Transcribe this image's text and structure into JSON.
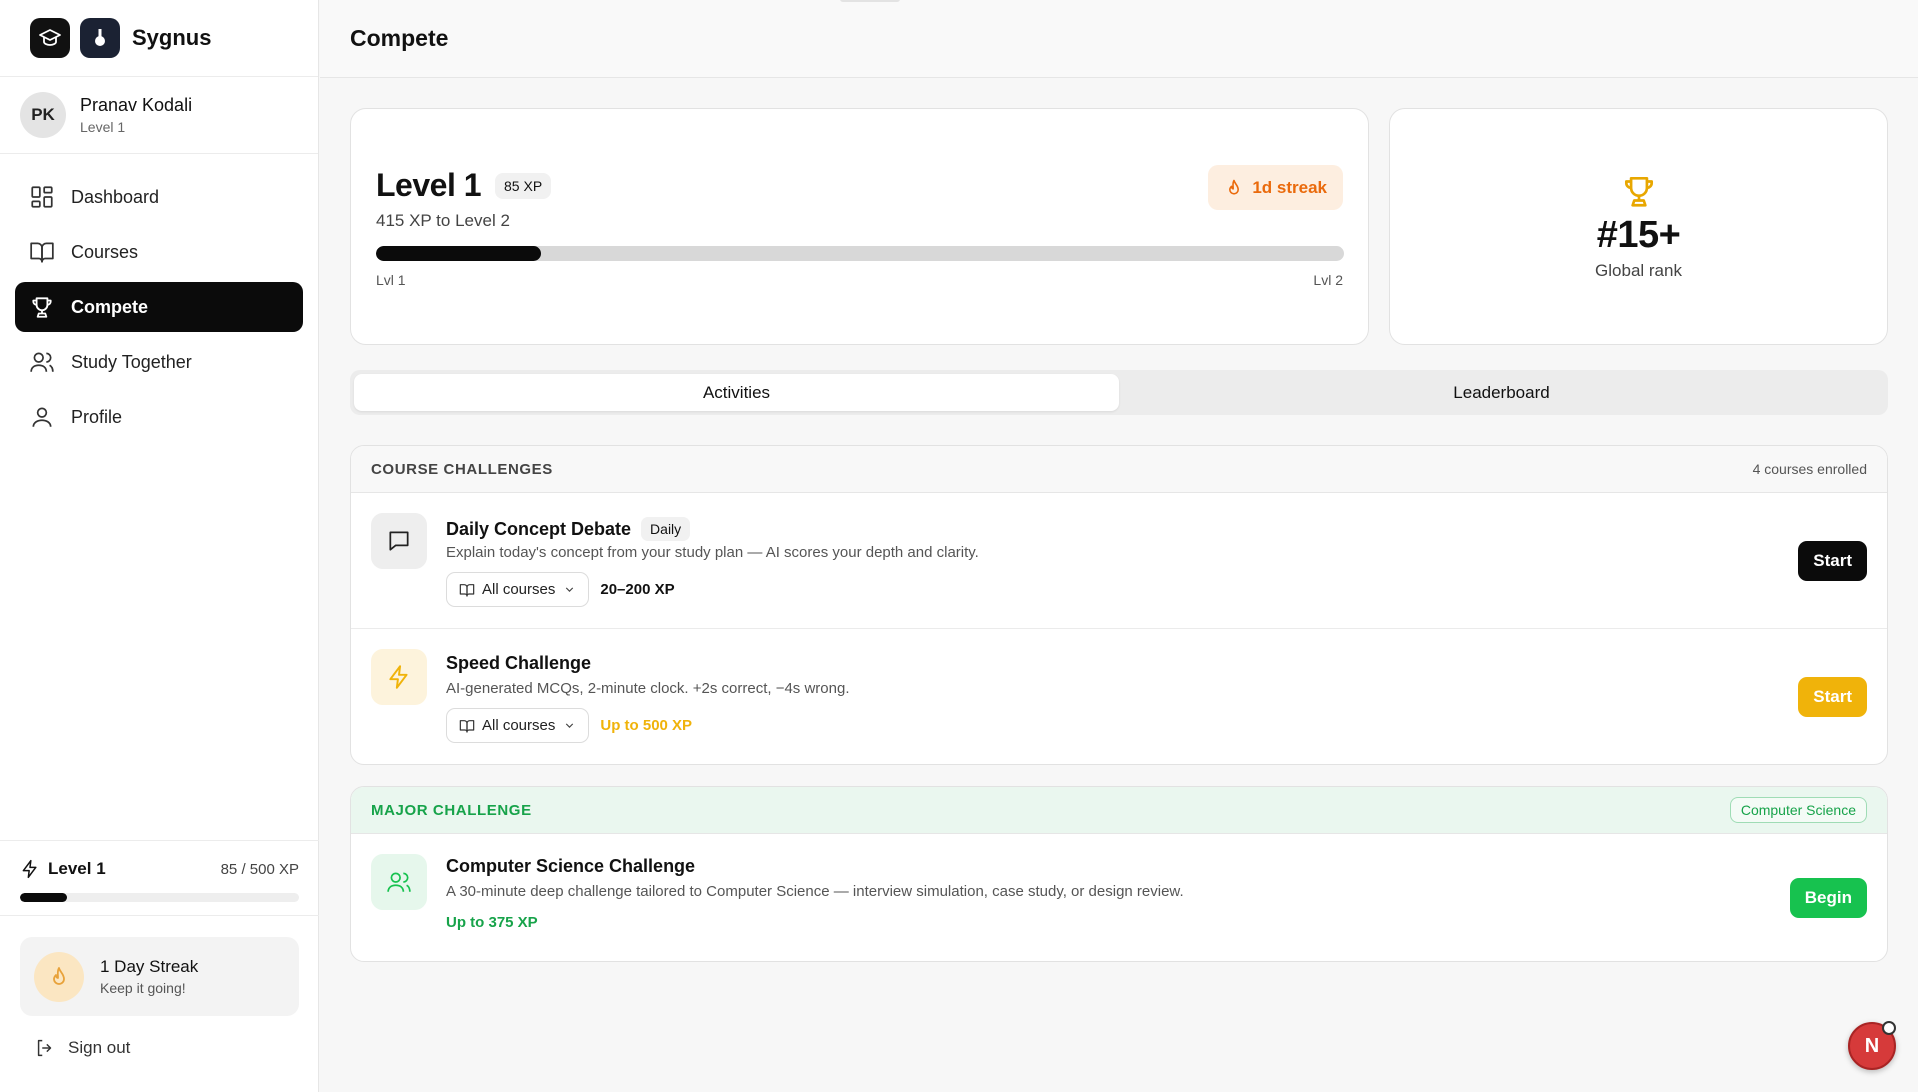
{
  "brand": {
    "name": "Sygnus"
  },
  "user": {
    "initials": "PK",
    "name": "Pranav Kodali",
    "level": "Level 1"
  },
  "nav": [
    {
      "label": "Dashboard",
      "icon": "grid-icon",
      "active": false
    },
    {
      "label": "Courses",
      "icon": "book-icon",
      "active": false
    },
    {
      "label": "Compete",
      "icon": "trophy-icon",
      "active": true
    },
    {
      "label": "Study Together",
      "icon": "users-icon",
      "active": false
    },
    {
      "label": "Profile",
      "icon": "user-icon",
      "active": false
    }
  ],
  "sidebar_level": {
    "label": "Level 1",
    "xp": "85 / 500 XP",
    "progress": 0.17
  },
  "sidebar_streak": {
    "title": "1 Day Streak",
    "subtitle": "Keep it going!"
  },
  "signout": {
    "label": "Sign out"
  },
  "page": {
    "title": "Compete"
  },
  "level_card": {
    "level": "Level 1",
    "xp_badge": "85 XP",
    "subtitle": "415 XP to Level 2",
    "streak": "1d streak",
    "progress": 0.17,
    "start_label": "Lvl 1",
    "end_label": "Lvl 2"
  },
  "rank_card": {
    "rank": "#15+",
    "label": "Global rank"
  },
  "tabs": [
    {
      "label": "Activities",
      "active": true
    },
    {
      "label": "Leaderboard",
      "active": false
    }
  ],
  "course_challenges": {
    "title": "COURSE CHALLENGES",
    "meta": "4 courses enrolled",
    "items": [
      {
        "title": "Daily Concept Debate",
        "tag": "Daily",
        "description": "Explain today's concept from your study plan — AI scores your depth and clarity.",
        "dropdown": "All courses",
        "xp": "20–200 XP",
        "button": "Start",
        "icon": "chat-icon"
      },
      {
        "title": "Speed Challenge",
        "description": "AI-generated MCQs, 2-minute clock. +2s correct, −4s wrong.",
        "dropdown": "All courses",
        "xp": "Up to 500 XP",
        "button": "Start",
        "icon": "bolt-icon"
      }
    ]
  },
  "major_challenge": {
    "title": "MAJOR CHALLENGE",
    "subject": "Computer Science",
    "item": {
      "title": "Computer Science Challenge",
      "description": "A 30-minute deep challenge tailored to Computer Science — interview simulation, case study, or design review.",
      "xp": "Up to 375 XP",
      "button": "Begin",
      "icon": "users-icon"
    }
  },
  "fab": {
    "label": "N"
  },
  "colors": {
    "accent": "#0b0b0b",
    "streak_orange": "#ea6a0c",
    "speed_yellow": "#f0b30a",
    "major_green": "#17c24f",
    "rank_gold": "#e8a700"
  }
}
